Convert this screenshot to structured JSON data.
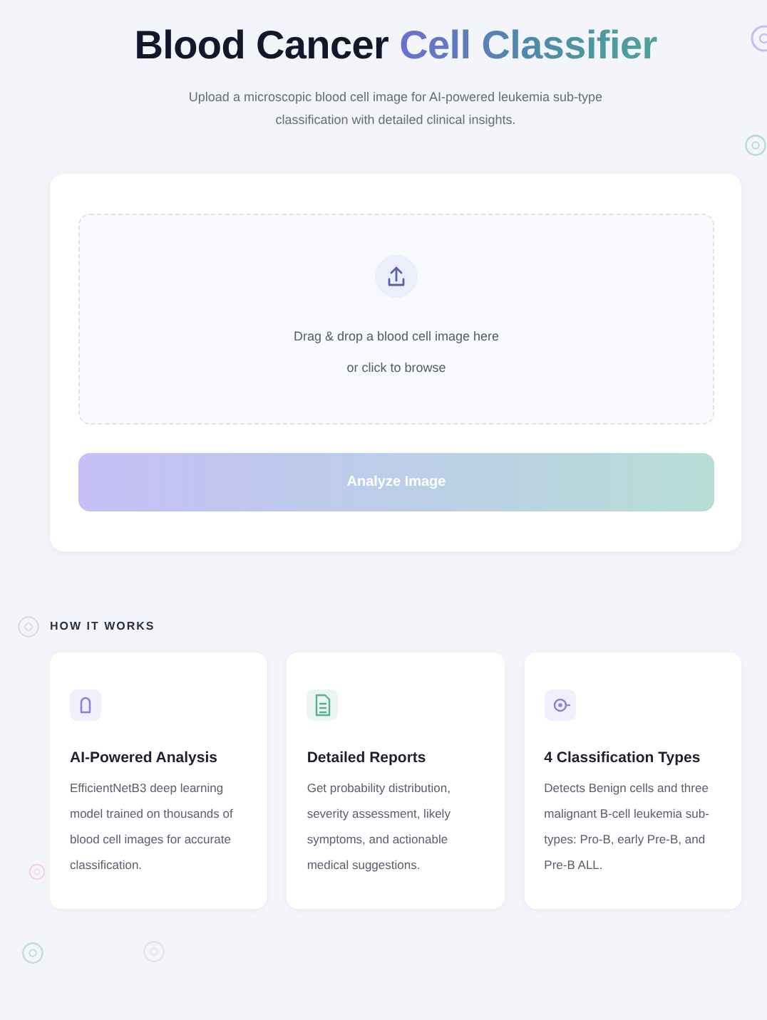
{
  "header": {
    "title": "Blood Cancer",
    "title_highlight": "Cell Classifier",
    "subtitle": "Upload a microscopic blood cell image for AI-powered leukemia sub-type classification with detailed clinical insights."
  },
  "upload": {
    "prompt": "Drag & drop a blood cell image here",
    "hint": "or click to browse"
  },
  "analyze_button": {
    "label": "Analyze Image",
    "disabled": true
  },
  "how_it_works": {
    "heading": "HOW IT WORKS",
    "cards": [
      {
        "title": "AI-Powered Analysis",
        "text": "EfficientNetB3 deep learning model trained on thousands of blood cell images for accurate classification."
      },
      {
        "title": "Detailed Reports",
        "text": "Get probability distribution, severity assessment, likely symptoms, and actionable medical suggestions."
      },
      {
        "title": "4 Classification Types",
        "text": "Detects Benign cells and three malignant B-cell leukemia sub-types: Pro-B, early Pre-B, and Pre-B ALL."
      }
    ]
  }
}
